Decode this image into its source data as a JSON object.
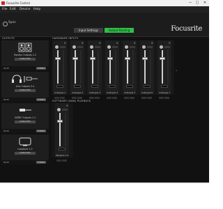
{
  "window": {
    "title": "Focusrite Control",
    "controls": [
      "—",
      "□",
      "✕"
    ]
  },
  "menu": [
    "File",
    "Edit",
    "Device",
    "Help"
  ],
  "toolbar": {
    "sync_label": "Sync",
    "tabs": [
      "Input Settings",
      "Output Routing"
    ],
    "active_tab": "Output Routing",
    "logo": "Focusrite",
    "accent_color": "#2fbf48"
  },
  "sections": {
    "outputs": "OUTPUTS",
    "hardware_inputs": "HARDWARE INPUTS",
    "software_playback": "SOFTWARE (DAW) PLAYBACK"
  },
  "outputs": [
    {
      "name": "Monitor Outputs 1-2",
      "icon": "speakers-icon",
      "mix": "Custom Mix",
      "mute": "MUTE",
      "mode": "STEREO"
    },
    {
      "name": "Line Outputs 3-4",
      "icon": "headphones-icon",
      "mix": "Custom Mix",
      "mute": "MUTE",
      "mode": "STEREO"
    },
    {
      "name": "S/PDIF Outputs 1-2",
      "icon": "spdif-cable-icon",
      "mix": "Custom Mix",
      "mute": "MUTE",
      "mode": "STEREO"
    },
    {
      "name": "Loopback 1-2",
      "icon": "loopback-icon",
      "mix": "Custom Mix",
      "mute": "MUTE",
      "mode": "STEREO"
    }
  ],
  "hardware_inputs": [
    {
      "label": "Analogue 1"
    },
    {
      "label": "Analogue 2"
    },
    {
      "label": "Analogue 3"
    },
    {
      "label": "Analogue 4"
    },
    {
      "label": "Analogue 5"
    },
    {
      "label": "Analogue 6"
    },
    {
      "label": "Analogue 7"
    }
  ],
  "software_playback": [
    {
      "label": "Playback 1-2"
    }
  ]
}
